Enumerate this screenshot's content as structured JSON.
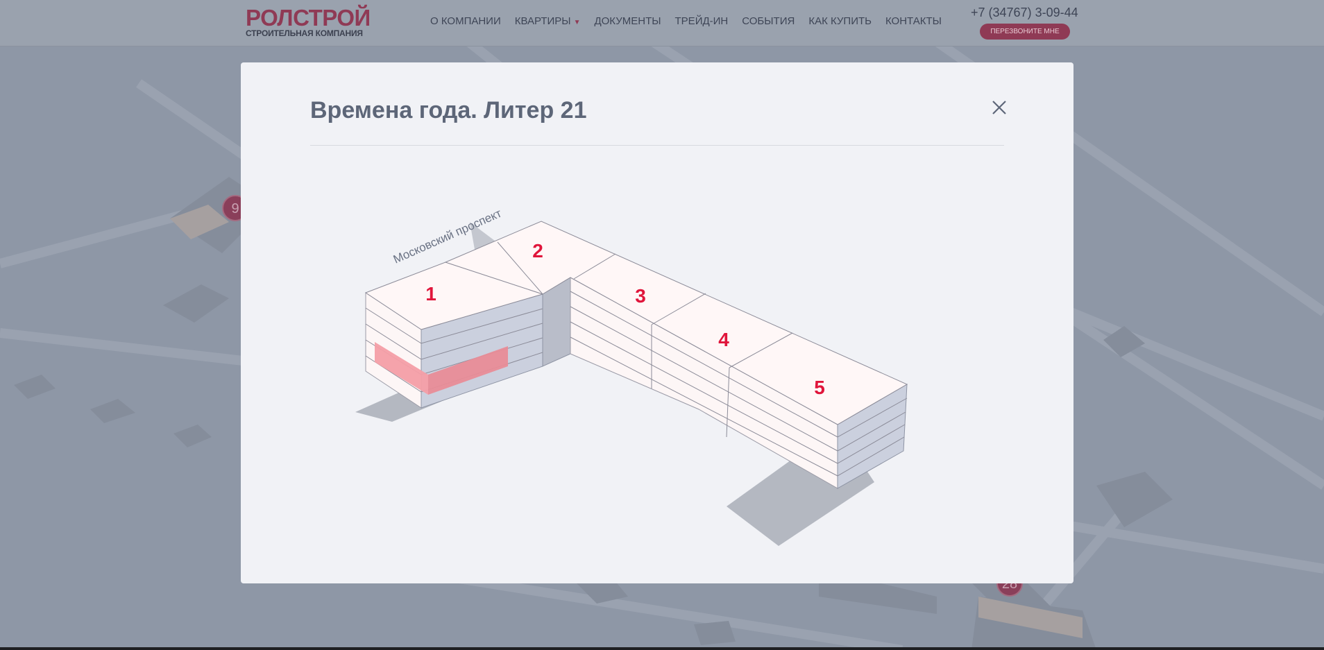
{
  "header": {
    "logo_main": "РОЛСТРОЙ",
    "logo_sub": "СТРОИТЕЛЬНАЯ КОМПАНИЯ",
    "nav": [
      "О КОМПАНИИ",
      "КВАРТИРЫ",
      "ДОКУМЕНТЫ",
      "ТРЕЙД-ИН",
      "СОБЫТИЯ",
      "КАК КУПИТЬ",
      "КОНТАКТЫ"
    ],
    "phone": "+7 (34767) 3-09-44",
    "callback_label": "ПЕРЕЗВОНИТЕ МНЕ"
  },
  "map": {
    "markers": [
      "9",
      "28"
    ]
  },
  "modal": {
    "title": "Времена года. Литер 21",
    "street": "Московский проспект",
    "sections": [
      "1",
      "2",
      "3",
      "4",
      "5"
    ],
    "highlight_color": "#f0a0a8",
    "accent_color": "#e0153b"
  }
}
